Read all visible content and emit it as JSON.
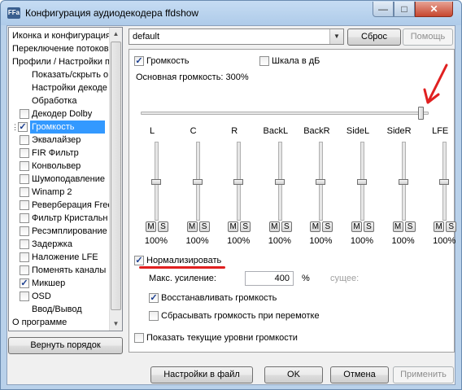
{
  "window": {
    "title": "Конфигурация аудиодекодера ffdshow",
    "app_icon_text": "FFa",
    "minimize_glyph": "—",
    "maximize_glyph": "□",
    "close_glyph": "✕"
  },
  "tree": {
    "items": [
      {
        "label": "Иконка и конфигурация"
      },
      {
        "label": "Переключение потоков"
      },
      {
        "label": "Профили / Настройки п"
      },
      {
        "label": "Показать/скрыть о"
      },
      {
        "label": "Настройки декоде"
      },
      {
        "label": "Обработка"
      },
      {
        "label": "Декодер Dolby",
        "check": ""
      },
      {
        "label": "Громкость",
        "check": "✓"
      },
      {
        "label": "Эквалайзер",
        "check": ""
      },
      {
        "label": "FIR Фильтр",
        "check": ""
      },
      {
        "label": "Конвольвер",
        "check": ""
      },
      {
        "label": "Шумоподавление",
        "check": ""
      },
      {
        "label": "Winamp 2",
        "check": ""
      },
      {
        "label": "Реверберация Free",
        "check": ""
      },
      {
        "label": "Фильтр Кристальн",
        "check": ""
      },
      {
        "label": "Ресэмплирование",
        "check": ""
      },
      {
        "label": "Задержка",
        "check": ""
      },
      {
        "label": "Наложение LFE",
        "check": ""
      },
      {
        "label": "Поменять каналы м",
        "check": ""
      },
      {
        "label": "Микшер",
        "check": "✓"
      },
      {
        "label": "OSD",
        "check": ""
      },
      {
        "label": "Ввод/Вывод"
      },
      {
        "label": "О программе"
      }
    ],
    "scroll_up": "▲",
    "scroll_down": "▼"
  },
  "buttons": {
    "reset_order": "Вернуть порядок",
    "reset": "Сброс",
    "help": "Помощь",
    "save_to_file": "Настройки в файл",
    "ok": "OK",
    "cancel": "Отмена",
    "apply": "Применить"
  },
  "profile": {
    "selected": "default",
    "arrow": "▼"
  },
  "volume": {
    "volume_label": "Громкость",
    "volume_check": "✓",
    "db_scale_label": "Шкала в дБ",
    "db_scale_check": "",
    "master_label": "Основная громкость: 300%",
    "master_level": 1.0,
    "channels": [
      {
        "name": "L",
        "level": 0.5,
        "m": "M",
        "s": "S",
        "pct": "100%"
      },
      {
        "name": "C",
        "level": 0.5,
        "m": "M",
        "s": "S",
        "pct": "100%"
      },
      {
        "name": "R",
        "level": 0.5,
        "m": "M",
        "s": "S",
        "pct": "100%"
      },
      {
        "name": "BackL",
        "level": 0.5,
        "m": "M",
        "s": "S",
        "pct": "100%"
      },
      {
        "name": "BackR",
        "level": 0.5,
        "m": "M",
        "s": "S",
        "pct": "100%"
      },
      {
        "name": "SideL",
        "level": 0.5,
        "m": "M",
        "s": "S",
        "pct": "100%"
      },
      {
        "name": "SideR",
        "level": 0.5,
        "m": "M",
        "s": "S",
        "pct": "100%"
      },
      {
        "name": "LFE",
        "level": 0.5,
        "m": "M",
        "s": "S",
        "pct": "100%"
      }
    ],
    "normalize_label": "Нормализировать",
    "normalize_check": "✓",
    "max_gain_label": "Макс. усиление:",
    "max_gain_value": "400",
    "max_gain_unit": "%",
    "current_label": "сущее:",
    "restore_label": "Восстанавливать громкость",
    "restore_check": "✓",
    "reset_on_seek_label": "Сбрасывать громкость при перемотке",
    "reset_on_seek_check": "",
    "show_levels_label": "Показать текущие уровни громкости",
    "show_levels_check": ""
  },
  "colors": {
    "annotation_red": "#e02020",
    "selection": "#3399ff"
  }
}
